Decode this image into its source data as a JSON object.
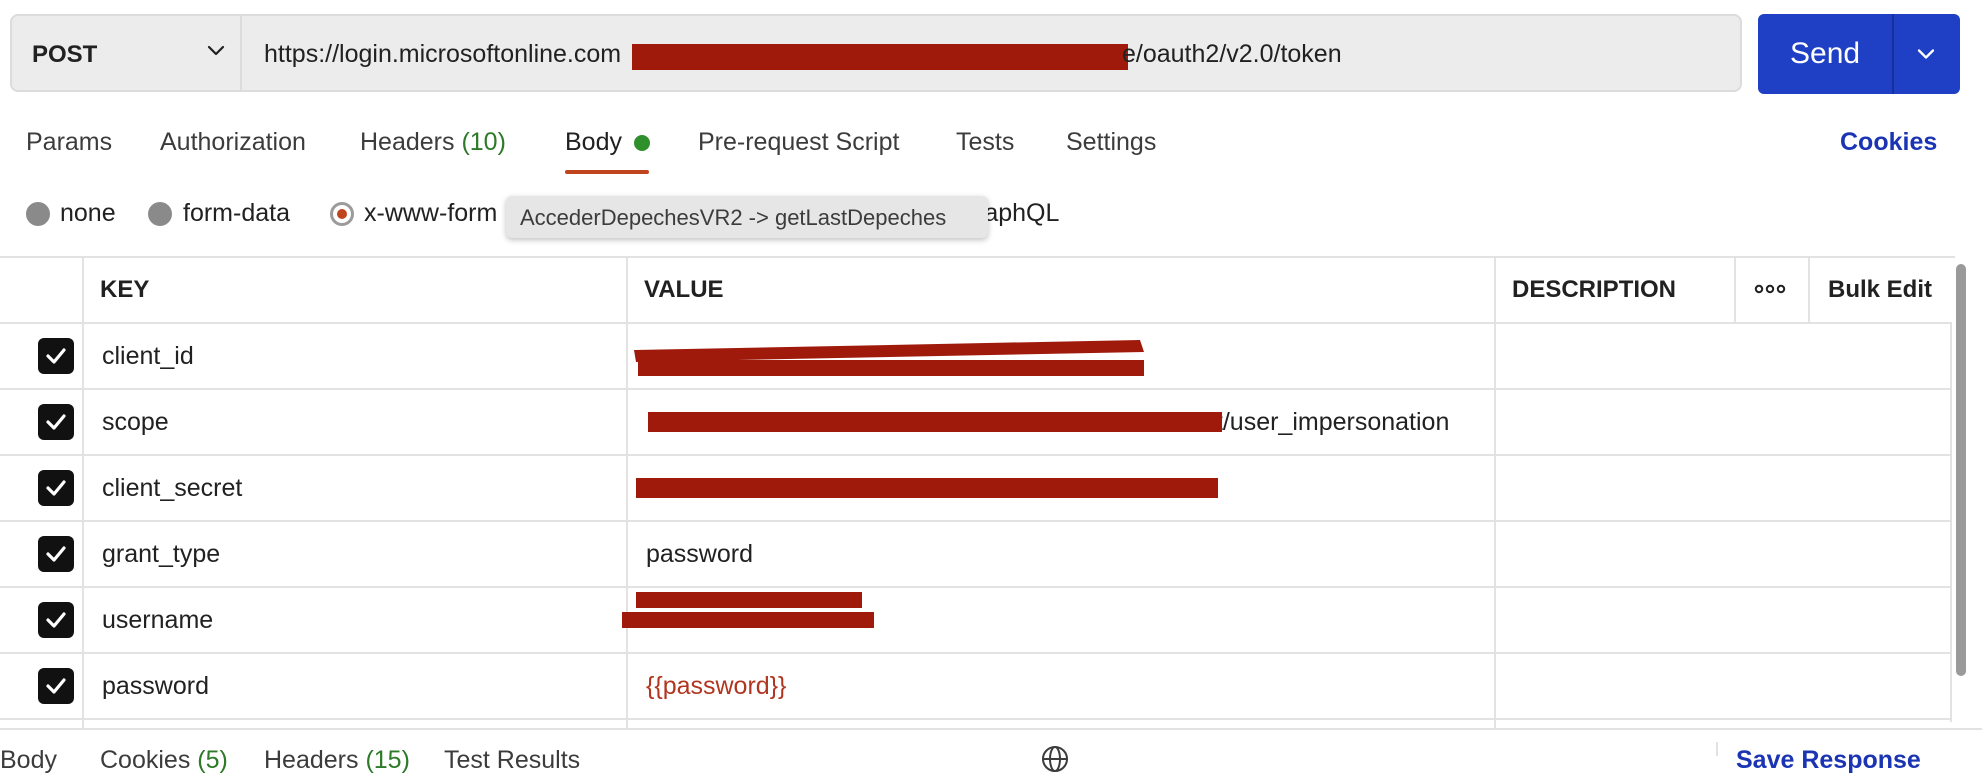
{
  "request": {
    "method": "POST",
    "url_prefix": "https://login.microsoftonline.com",
    "url_suffix": "e/oauth2/v2.0/token",
    "send_label": "Send"
  },
  "tabs": [
    {
      "label": "Params"
    },
    {
      "label": "Authorization"
    },
    {
      "label": "Headers",
      "count": "(10)"
    },
    {
      "label": "Body"
    },
    {
      "label": "Pre-request Script"
    },
    {
      "label": "Tests"
    },
    {
      "label": "Settings"
    }
  ],
  "cookies_label": "Cookies",
  "body_types": [
    {
      "label": "none"
    },
    {
      "label": "form-data"
    },
    {
      "label": "x-www-form",
      "selected": true
    },
    {
      "label": "raphQL"
    }
  ],
  "tooltip": "AccederDepechesVR2 -> getLastDepeches",
  "table": {
    "headers": {
      "key": "KEY",
      "value": "VALUE",
      "description": "DESCRIPTION",
      "bulk_edit": "Bulk Edit"
    },
    "rows": [
      {
        "key": "client_id",
        "value": "",
        "checked": true
      },
      {
        "key": "scope",
        "value": "et/user_impersonation",
        "checked": true
      },
      {
        "key": "client_secret",
        "value": "",
        "checked": true
      },
      {
        "key": "grant_type",
        "value": "password",
        "checked": true
      },
      {
        "key": "username",
        "value": "",
        "checked": true
      },
      {
        "key": "password",
        "value": "{{password}}",
        "checked": true
      }
    ]
  },
  "response": {
    "tabs": [
      {
        "label": "Body"
      },
      {
        "label": "Cookies",
        "count": "(5)"
      },
      {
        "label": "Headers",
        "count": "(15)"
      },
      {
        "label": "Test Results"
      }
    ],
    "save_label": "Save Response"
  },
  "colors": {
    "send": "#1f3fc5",
    "accent": "#c0441e",
    "count_green": "#2d7a28",
    "cookies_link": "#1a34b3",
    "redaction": "#a01a0c",
    "variable": "#b1361f"
  }
}
